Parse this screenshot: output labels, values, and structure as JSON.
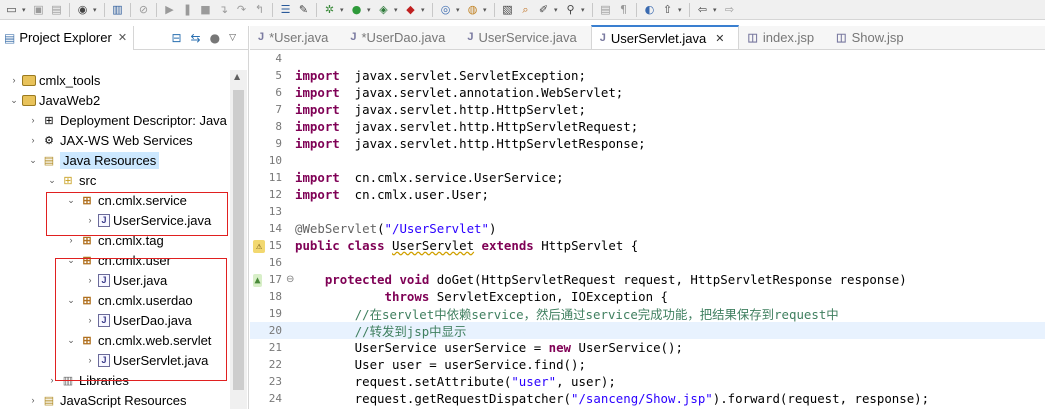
{
  "explorer": {
    "tab_label": "Project Explorer",
    "tab_close": "✕",
    "tree": [
      {
        "indent": 0,
        "arrow": "›",
        "icon": "project",
        "label": "cmlx_tools"
      },
      {
        "indent": 0,
        "arrow": "⌄",
        "icon": "project",
        "label": "JavaWeb2"
      },
      {
        "indent": 1,
        "arrow": "›",
        "icon": "deploy",
        "label": "Deployment Descriptor: Java"
      },
      {
        "indent": 1,
        "arrow": "›",
        "icon": "webservice",
        "label": "JAX-WS Web Services"
      },
      {
        "indent": 1,
        "arrow": "⌄",
        "icon": "javares",
        "label": "Java Resources",
        "selected": true
      },
      {
        "indent": 2,
        "arrow": "⌄",
        "icon": "srcfolder",
        "label": "src"
      },
      {
        "indent": 3,
        "arrow": "⌄",
        "icon": "package",
        "label": "cn.cmlx.service"
      },
      {
        "indent": 4,
        "arrow": "›",
        "icon": "java",
        "label": "UserService.java"
      },
      {
        "indent": 3,
        "arrow": "›",
        "icon": "package",
        "label": "cn.cmlx.tag"
      },
      {
        "indent": 3,
        "arrow": "⌄",
        "icon": "package",
        "label": "cn.cmlx.user"
      },
      {
        "indent": 4,
        "arrow": "›",
        "icon": "java",
        "label": "User.java"
      },
      {
        "indent": 3,
        "arrow": "⌄",
        "icon": "package",
        "label": "cn.cmlx.userdao"
      },
      {
        "indent": 4,
        "arrow": "›",
        "icon": "java",
        "label": "UserDao.java"
      },
      {
        "indent": 3,
        "arrow": "⌄",
        "icon": "package",
        "label": "cn.cmlx.web.servlet"
      },
      {
        "indent": 4,
        "arrow": "›",
        "icon": "java",
        "label": "UserServlet.java"
      },
      {
        "indent": 2,
        "arrow": "›",
        "icon": "library",
        "label": "Libraries"
      },
      {
        "indent": 1,
        "arrow": "›",
        "icon": "jsres",
        "label": "JavaScript Resources"
      }
    ]
  },
  "editor": {
    "tabs": [
      {
        "label": "*User.java",
        "active": false
      },
      {
        "label": "*UserDao.java",
        "active": false
      },
      {
        "label": "UserService.java",
        "active": false
      },
      {
        "label": "UserServlet.java",
        "active": true,
        "close": "✕"
      },
      {
        "label": "index.jsp",
        "active": false
      },
      {
        "label": "Show.jsp",
        "active": false
      }
    ],
    "lines": [
      {
        "n": "4",
        "tokens": []
      },
      {
        "n": "5",
        "tokens": [
          [
            "kw",
            "import"
          ],
          [
            "",
            "  javax.servlet.ServletException;"
          ]
        ]
      },
      {
        "n": "6",
        "tokens": [
          [
            "kw",
            "import"
          ],
          [
            "",
            "  javax.servlet.annotation.WebServlet;"
          ]
        ]
      },
      {
        "n": "7",
        "tokens": [
          [
            "kw",
            "import"
          ],
          [
            "",
            "  javax.servlet.http.HttpServlet;"
          ]
        ]
      },
      {
        "n": "8",
        "tokens": [
          [
            "kw",
            "import"
          ],
          [
            "",
            "  javax.servlet.http.HttpServletRequest;"
          ]
        ]
      },
      {
        "n": "9",
        "tokens": [
          [
            "kw",
            "import"
          ],
          [
            "",
            "  javax.servlet.http.HttpServletResponse;"
          ]
        ]
      },
      {
        "n": "10",
        "tokens": []
      },
      {
        "n": "11",
        "tokens": [
          [
            "kw",
            "import"
          ],
          [
            "",
            "  cn.cmlx.service.UserService;"
          ]
        ]
      },
      {
        "n": "12",
        "tokens": [
          [
            "kw",
            "import"
          ],
          [
            "",
            "  cn.cmlx.user.User;"
          ]
        ]
      },
      {
        "n": "13",
        "tokens": []
      },
      {
        "n": "14",
        "tokens": [
          [
            "ann",
            "@WebServlet"
          ],
          [
            "",
            "("
          ],
          [
            "str",
            "\"/UserServlet\""
          ],
          [
            "",
            ")"
          ]
        ]
      },
      {
        "n": "15",
        "mark": "warn",
        "tokens": [
          [
            "kw",
            "public"
          ],
          [
            "",
            " "
          ],
          [
            "kw",
            "class"
          ],
          [
            "",
            " "
          ],
          [
            "wavy",
            "UserServlet"
          ],
          [
            "",
            " "
          ],
          [
            "kw",
            "extends"
          ],
          [
            "",
            " HttpServlet {"
          ]
        ]
      },
      {
        "n": "16",
        "tokens": []
      },
      {
        "n": "17",
        "mark": "fold",
        "tokens": [
          [
            "",
            "    "
          ],
          [
            "kw",
            "protected"
          ],
          [
            "",
            " "
          ],
          [
            "kw",
            "void"
          ],
          [
            "",
            " doGet(HttpServletRequest request, HttpServletResponse response)"
          ]
        ]
      },
      {
        "n": "18",
        "tokens": [
          [
            "",
            "            "
          ],
          [
            "kw",
            "throws"
          ],
          [
            "",
            " ServletException, IOException {"
          ]
        ]
      },
      {
        "n": "19",
        "tokens": [
          [
            "",
            "        "
          ],
          [
            "cm",
            "//在servlet中依赖service，然后通过service完成功能，把结果保存到request中"
          ]
        ]
      },
      {
        "n": "20",
        "hl": true,
        "tokens": [
          [
            "",
            "        "
          ],
          [
            "cm",
            "//转发到jsp中显示"
          ]
        ]
      },
      {
        "n": "21",
        "tokens": [
          [
            "",
            "        UserService userService = "
          ],
          [
            "kw",
            "new"
          ],
          [
            "",
            " UserService();"
          ]
        ]
      },
      {
        "n": "22",
        "tokens": [
          [
            "",
            "        User user = userService.find();"
          ]
        ]
      },
      {
        "n": "23",
        "tokens": [
          [
            "",
            "        request.setAttribute("
          ],
          [
            "str",
            "\"user\""
          ],
          [
            "",
            ", user);"
          ]
        ]
      },
      {
        "n": "24",
        "tokens": [
          [
            "",
            "        request.getRequestDispatcher("
          ],
          [
            "str",
            "\"/sanceng/Show.jsp\""
          ],
          [
            "",
            ").forward(request, response);"
          ]
        ]
      }
    ]
  },
  "toolbar": {
    "icons": [
      "new-icon",
      "save-icon",
      "save-all-icon",
      "account-icon",
      "outline-icon",
      "debug-skip-icon",
      "resume-icon",
      "suspend-icon",
      "terminate-icon",
      "step-into-icon",
      "step-over-icon",
      "step-return-icon",
      "task-icon",
      "build-icon",
      "debug-icon",
      "run-icon",
      "run-config-icon",
      "external-tools-icon",
      "new-server-icon",
      "open-type-icon",
      "open-task-icon",
      "search-icon",
      "annotation-icon",
      "pin-icon",
      "toggle-icon",
      "block-icon",
      "world-icon",
      "deploy-icon",
      "nav-back-icon",
      "nav-forward-icon"
    ]
  }
}
